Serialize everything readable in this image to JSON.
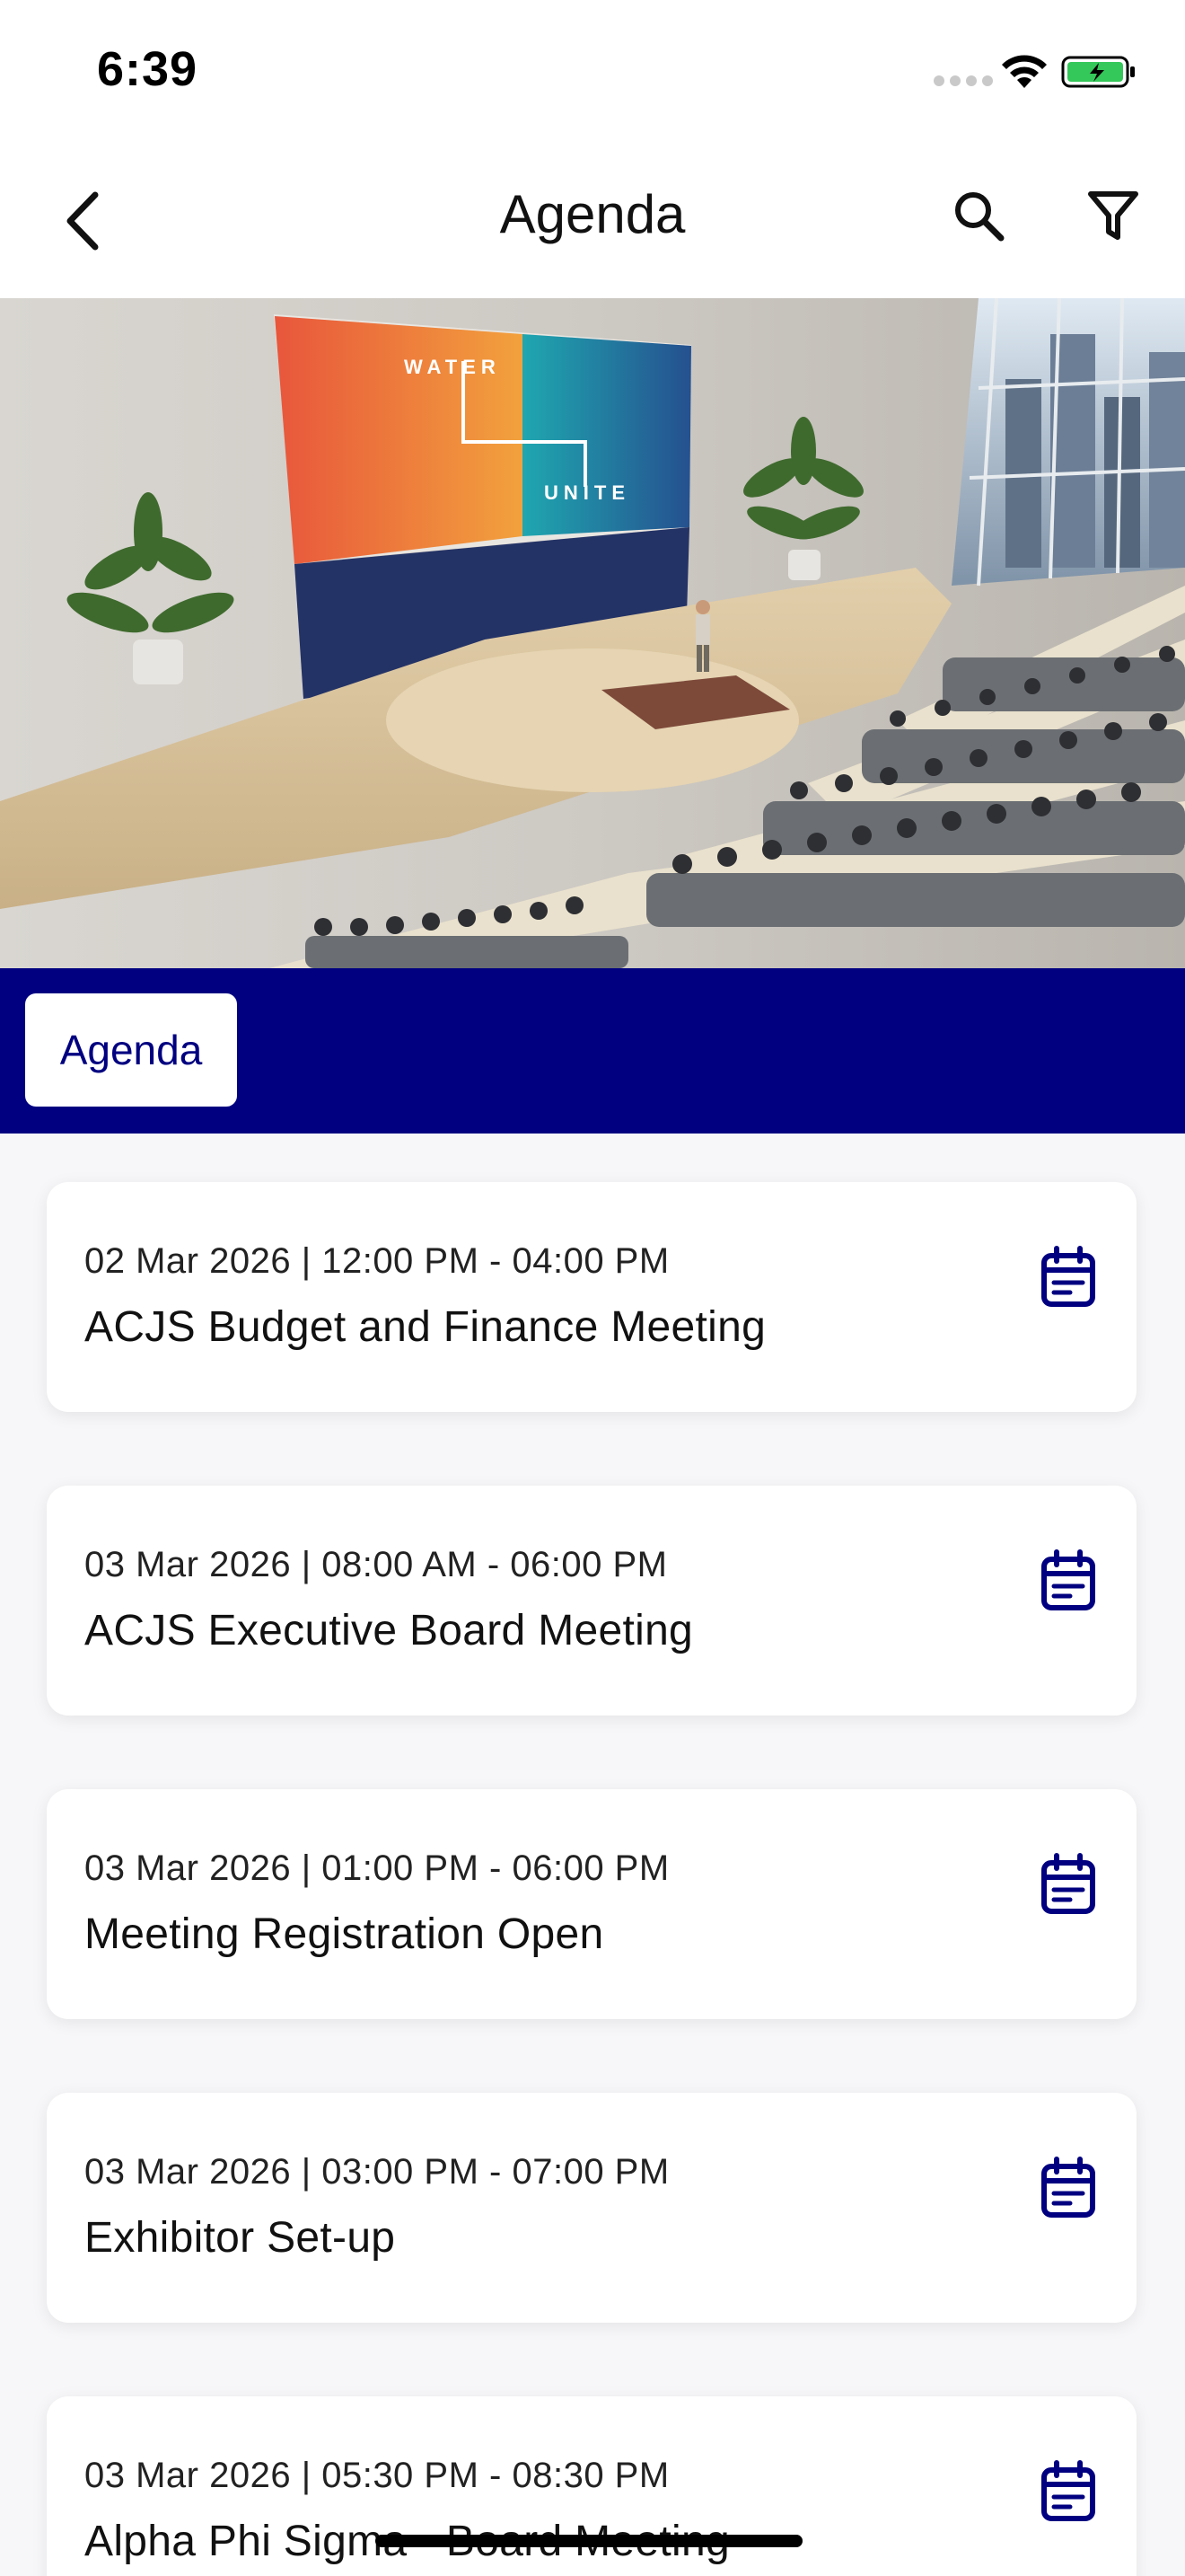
{
  "status": {
    "time": "6:39"
  },
  "header": {
    "title": "Agenda"
  },
  "banner": {
    "screen_text_top": "WATER",
    "screen_text_bottom": "UNITE"
  },
  "tabs": [
    {
      "label": "Agenda",
      "active": true
    }
  ],
  "agenda": [
    {
      "when": "02 Mar 2026 | 12:00 PM - 04:00 PM",
      "title": "ACJS Budget and Finance Meeting"
    },
    {
      "when": "03 Mar 2026 | 08:00 AM - 06:00 PM",
      "title": "ACJS Executive Board Meeting"
    },
    {
      "when": "03 Mar 2026 | 01:00 PM - 06:00 PM",
      "title": "Meeting Registration Open"
    },
    {
      "when": "03 Mar 2026 | 03:00 PM - 07:00 PM",
      "title": "Exhibitor Set-up"
    },
    {
      "when": "03 Mar 2026 | 05:30 PM - 08:30 PM",
      "title": "Alpha Phi Sigma - Board Meeting"
    }
  ],
  "colors": {
    "accent": "#000080",
    "background": "#f7f7f9",
    "card": "#ffffff"
  },
  "icons": [
    "back-chevron-icon",
    "search-icon",
    "filter-icon",
    "calendar-icon"
  ]
}
